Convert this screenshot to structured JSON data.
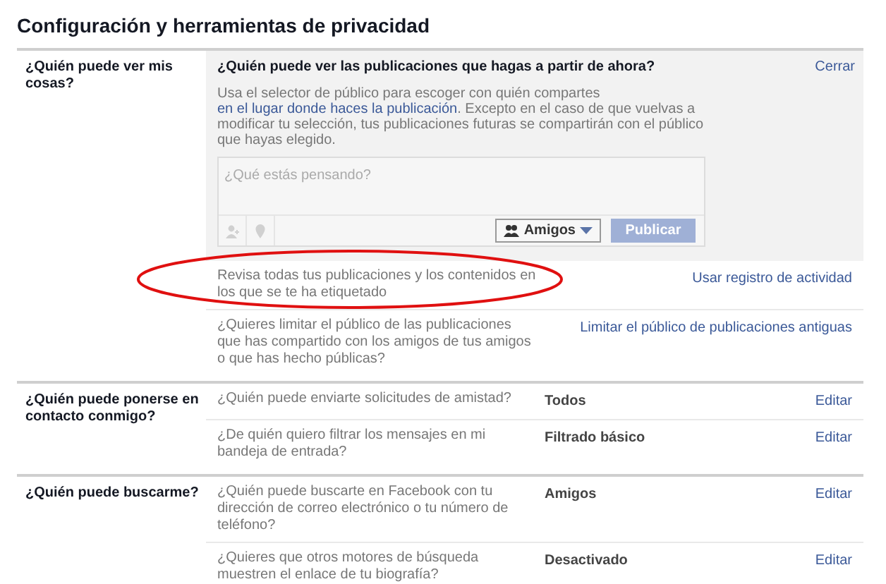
{
  "title": "Configuración y herramientas de privacidad",
  "sections": [
    {
      "label": "¿Quién puede ver mis cosas?",
      "panel": {
        "question": "¿Quién puede ver las publicaciones que hagas a partir de ahora?",
        "close": "Cerrar",
        "description": [
          {
            "kind": "text",
            "text": "Usa el selector de público para escoger con quién compartes "
          },
          {
            "kind": "link",
            "text": "en el lugar donde haces la publicación"
          },
          {
            "kind": "text",
            "text": ". Excepto en el caso de que vuelvas a modificar tu selección, tus publicaciones futuras se compartirán con el público que hayas elegido."
          }
        ],
        "composer": {
          "placeholder": "¿Qué estás pensando?",
          "audience": "Amigos",
          "post_button": "Publicar",
          "post_disabled": true
        }
      },
      "rows": [
        {
          "question": "Revisa todas tus publicaciones y los contenidos en los que se te ha etiquetado",
          "action": "Usar registro de actividad",
          "highlighted": true
        },
        {
          "question": "¿Quieres limitar el público de las publicaciones que has compartido con los amigos de tus amigos o que has hecho públicas?",
          "action": "Limitar el público de publicaciones antiguas",
          "highlighted": false
        }
      ]
    },
    {
      "label": "¿Quién puede ponerse en contacto conmigo?",
      "rows": [
        {
          "question": "¿Quién puede enviarte solicitudes de amistad?",
          "value": "Todos",
          "action": "Editar",
          "highlighted": false
        },
        {
          "question": "¿De quién quiero filtrar los mensajes en mi bandeja de entrada?",
          "value": "Filtrado básico",
          "action": "Editar",
          "highlighted": false
        }
      ]
    },
    {
      "label": "¿Quién puede buscarme?",
      "rows": [
        {
          "question": "¿Quién puede buscarte en Facebook con tu dirección de correo electrónico o tu número de teléfono?",
          "value": "Amigos",
          "action": "Editar",
          "highlighted": false
        },
        {
          "question": "¿Quieres que otros motores de búsqueda muestren el enlace de tu biografía?",
          "value": "Desactivado",
          "action": "Editar",
          "highlighted": false
        }
      ]
    }
  ]
}
